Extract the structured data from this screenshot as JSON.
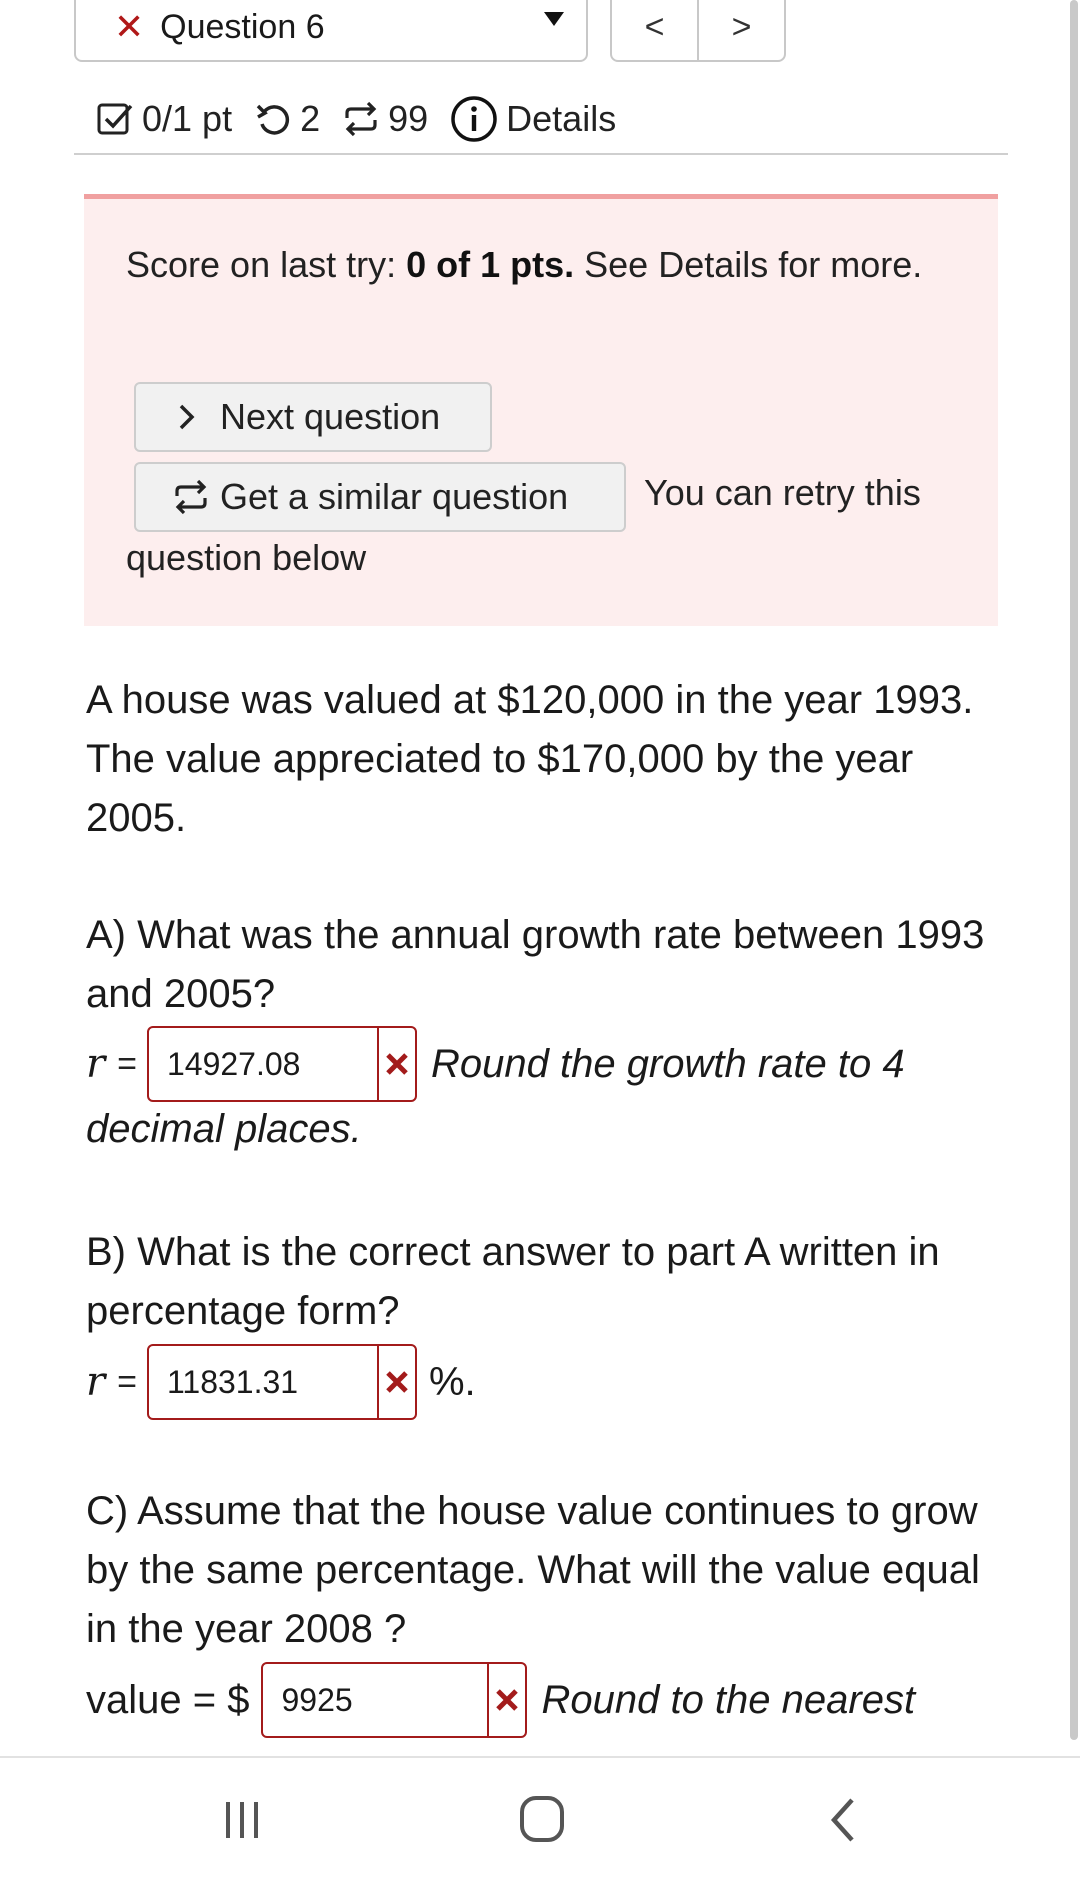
{
  "header": {
    "question_label": "Question 6",
    "prev_label": "<",
    "next_label": ">"
  },
  "status": {
    "points": "0/1 pt",
    "retries": "2",
    "attempts": "99",
    "details": "Details"
  },
  "score_box": {
    "prefix": "Score on last try: ",
    "score": "0 of 1 pts.",
    "suffix": " See Details for more.",
    "next_button": "Next question",
    "similar_button": "Get a similar question",
    "retry_text_a": "You can retry this",
    "retry_text_b": "question below"
  },
  "question": {
    "intro": "A house was valued at $120,000 in the year 1993. The value appreciated to $170,000 by the year 2005.",
    "part_a": "A) What was the annual growth rate between 1993 and 2005?",
    "part_a_var": "r",
    "part_a_value": "14927.08",
    "part_a_hint_a": "Round the growth rate to 4",
    "part_a_hint_b": "decimal places.",
    "part_b": "B) What is the correct answer to part A written in percentage form?",
    "part_b_var": "r",
    "part_b_value": "11831.31",
    "part_b_unit": "%.",
    "part_c": "C) Assume that the house value continues to grow by the same percentage. What will the value equal in the year 2008 ?",
    "part_c_label": "value = $",
    "part_c_value": "9925",
    "part_c_hint": "Round to the nearest"
  },
  "colors": {
    "error": "#a31b1b",
    "score_bg": "#fdeeee",
    "score_border": "#f0a0a0"
  }
}
